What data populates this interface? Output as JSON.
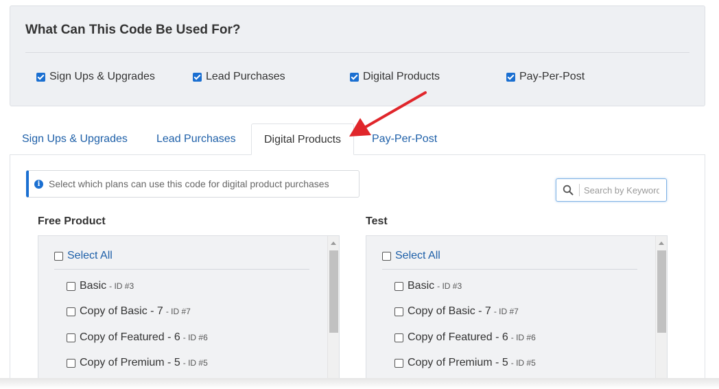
{
  "usage": {
    "title": "What Can This Code Be Used For?",
    "options": [
      {
        "label": "Sign Ups & Upgrades",
        "checked": true
      },
      {
        "label": "Lead Purchases",
        "checked": true
      },
      {
        "label": "Digital Products",
        "checked": true
      },
      {
        "label": "Pay-Per-Post",
        "checked": true
      }
    ]
  },
  "tabs": [
    {
      "label": "Sign Ups & Upgrades",
      "active": false
    },
    {
      "label": "Lead Purchases",
      "active": false
    },
    {
      "label": "Digital Products",
      "active": true
    },
    {
      "label": "Pay-Per-Post",
      "active": false
    }
  ],
  "info_note": {
    "icon": "info-icon",
    "text": "Select which plans can use this code for digital product purchases"
  },
  "search": {
    "placeholder": "Search by Keyword",
    "value": "",
    "icon": "search-icon"
  },
  "plan_columns": [
    {
      "title": "Free Product",
      "select_all_label": "Select All",
      "items": [
        {
          "name": "Basic",
          "id": "ID #3",
          "checked": false
        },
        {
          "name": "Copy of Basic - 7",
          "id": "ID #7",
          "checked": false
        },
        {
          "name": "Copy of Featured - 6",
          "id": "ID #6",
          "checked": false
        },
        {
          "name": "Copy of Premium - 5",
          "id": "ID #5",
          "checked": false
        }
      ]
    },
    {
      "title": "Test",
      "select_all_label": "Select All",
      "items": [
        {
          "name": "Basic",
          "id": "ID #3",
          "checked": false
        },
        {
          "name": "Copy of Basic - 7",
          "id": "ID #7",
          "checked": false
        },
        {
          "name": "Copy of Featured - 6",
          "id": "ID #6",
          "checked": false
        },
        {
          "name": "Copy of Premium - 5",
          "id": "ID #5",
          "checked": false
        }
      ]
    }
  ],
  "colors": {
    "accent": "#1a6fd1",
    "link": "#1d5fa8",
    "arrow": "#e0262b",
    "panel_bg": "#eef0f3"
  },
  "dash": "-"
}
